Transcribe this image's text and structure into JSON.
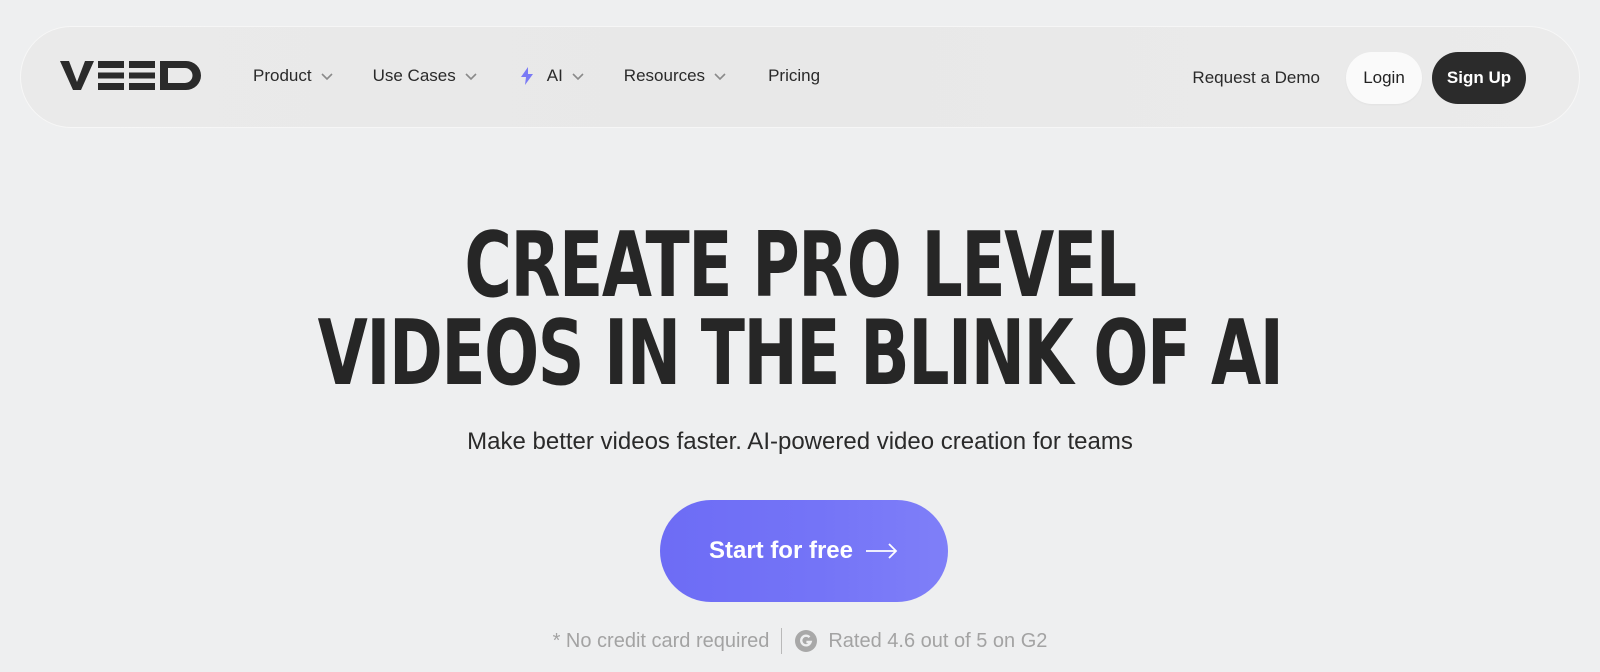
{
  "brand": {
    "name": "VEED",
    "text_color": "#2b2b2b"
  },
  "nav": {
    "items": [
      {
        "label": "Product",
        "icon": "chevron-down-icon"
      },
      {
        "label": "Use Cases",
        "icon": "chevron-down-icon"
      },
      {
        "label": "AI",
        "icon": "chevron-down-icon",
        "leading_icon": "sparkle-icon"
      },
      {
        "label": "Resources",
        "icon": "chevron-down-icon"
      },
      {
        "label": "Pricing"
      }
    ],
    "request_demo": "Request a Demo",
    "login": "Login",
    "signup": "Sign Up"
  },
  "hero": {
    "title_line1": "CREATE PRO LEVEL",
    "title_line2": "VIDEOS IN THE BLINK OF AI",
    "subtitle": "Make better videos faster. AI-powered video creation for teams",
    "cta": "Start for free",
    "cta_icon": "arrow-right-icon",
    "footnote_left": "* No credit card required",
    "footnote_right": "Rated 4.6 out of 5 on G2",
    "rating_icon": "g2-icon"
  },
  "colors": {
    "background": "#eeeff0",
    "accent": "#7373f6",
    "dark_button": "#2b2b2b",
    "ai_sparkle": "#7a7af5"
  }
}
